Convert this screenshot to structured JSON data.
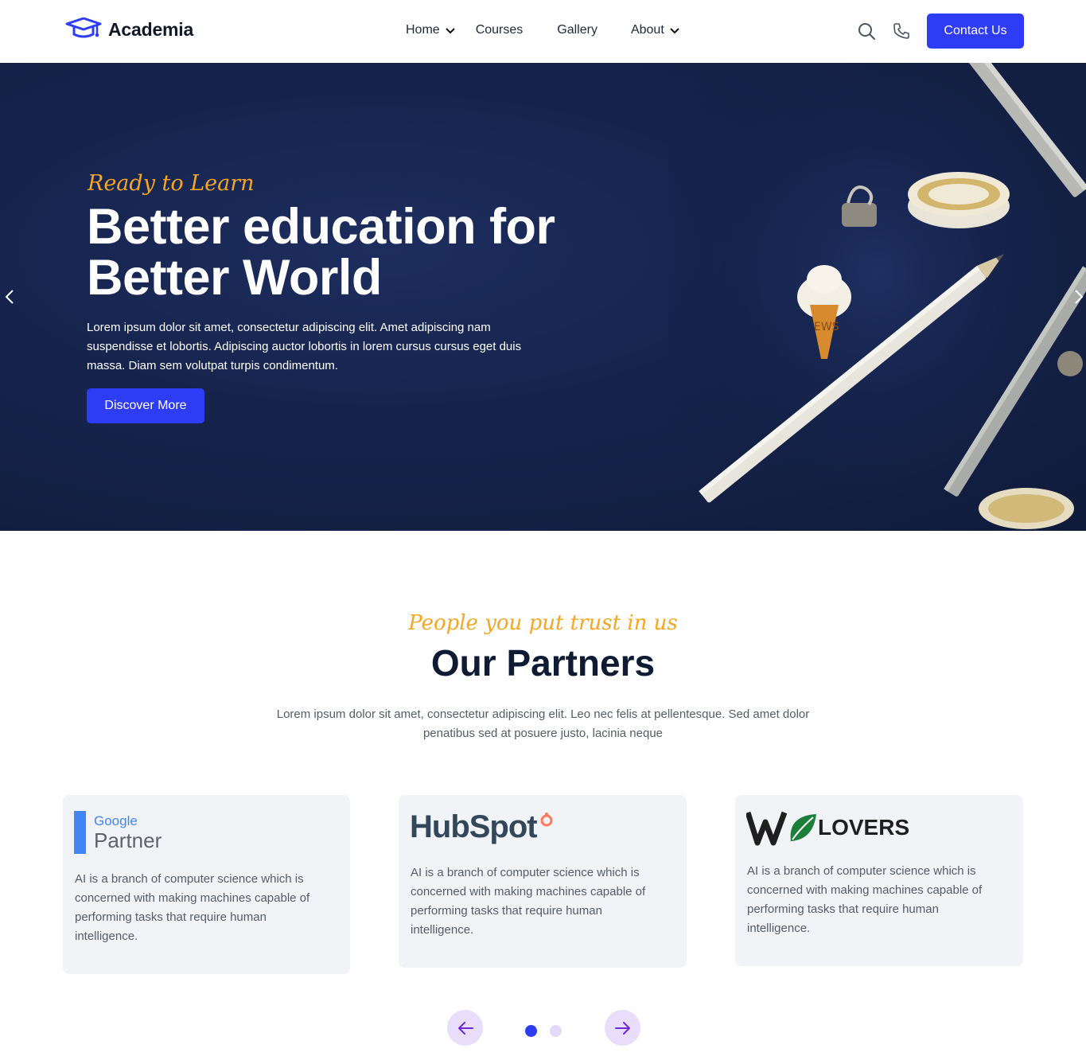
{
  "header": {
    "logo_text": "Academia",
    "nav": [
      {
        "label": "Home",
        "has_dropdown": true
      },
      {
        "label": "Courses",
        "has_dropdown": false
      },
      {
        "label": "Gallery",
        "has_dropdown": false
      },
      {
        "label": "About",
        "has_dropdown": true
      }
    ],
    "contact_label": "Contact Us"
  },
  "hero": {
    "tagline": "Ready to Learn",
    "title_line1": "Better education for",
    "title_line2": "Better World",
    "description": "Lorem ipsum dolor sit amet, consectetur adipiscing elit. Amet adipiscing nam suspendisse et lobortis. Adipiscing auctor lobortis in lorem cursus cursus eget duis massa. Diam sem volutpat turpis condimentum.",
    "cta_label": "Discover More"
  },
  "partners": {
    "tagline": "People you put trust in us",
    "title": "Our Partners",
    "description": "Lorem ipsum dolor sit amet, consectetur adipiscing elit. Leo nec felis at pellentesque. Sed amet dolor penatibus sed at posuere justo, lacinia neque",
    "cards": [
      {
        "logo_word_1": "Google",
        "logo_word_2": "Partner",
        "text": "AI is a branch of computer science which is concerned with making machines capable of performing tasks that require human intelligence."
      },
      {
        "logo_word_1": "HubSpot",
        "text": "AI is a branch of computer science which is concerned with making machines capable of performing tasks that require human intelligence."
      },
      {
        "logo_word_1": "LOVERS",
        "text": "AI is a branch of computer science which is concerned with making machines capable of performing tasks that require human intelligence."
      }
    ],
    "active_slide": 1,
    "slide_count": 2
  },
  "colors": {
    "accent": "#2f3cf5",
    "tagline": "#f5a623",
    "hero_bg": "#16244d",
    "card_bg": "#f2f3f7"
  },
  "icons": [
    "graduation-cap-icon",
    "search-icon",
    "phone-icon",
    "chevron-down-icon",
    "chevron-left-icon",
    "chevron-right-icon",
    "arrow-left-icon",
    "arrow-right-icon"
  ]
}
